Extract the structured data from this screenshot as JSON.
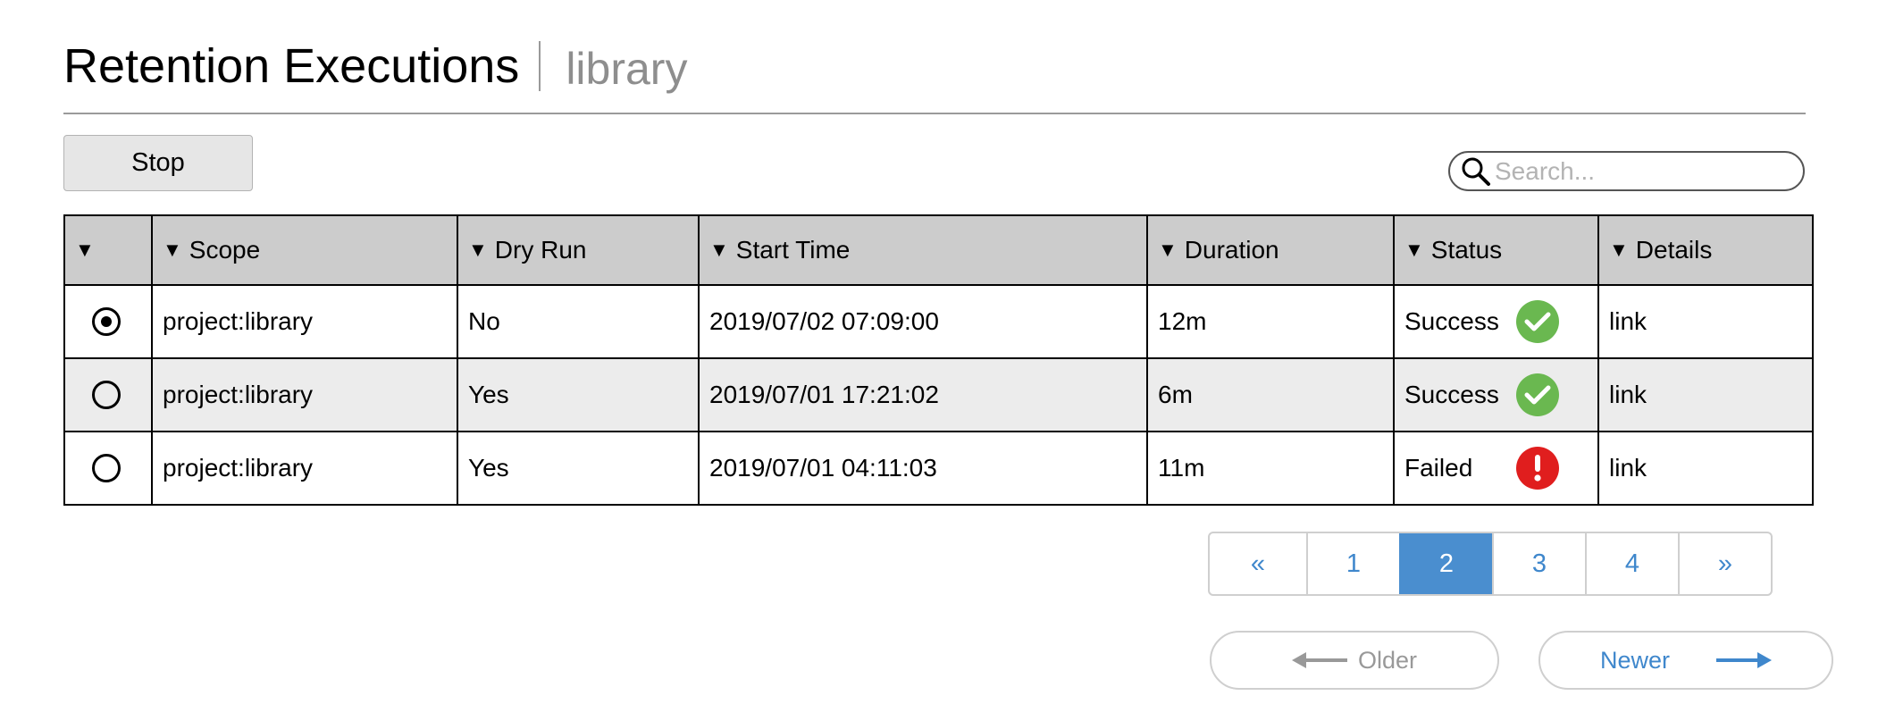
{
  "header": {
    "title": "Retention Executions",
    "subtitle": "library"
  },
  "toolbar": {
    "stop_label": "Stop"
  },
  "search": {
    "placeholder": "Search..."
  },
  "table": {
    "columns": [
      "",
      "Scope",
      "Dry Run",
      "Start Time",
      "Duration",
      "Status",
      "Details"
    ],
    "rows": [
      {
        "selected": true,
        "scope": "project:library",
        "dry_run": "No",
        "start_time": "2019/07/02 07:09:00",
        "duration": "12m",
        "status": "Success",
        "status_icon": "check-icon",
        "details": "link"
      },
      {
        "selected": false,
        "scope": "project:library",
        "dry_run": "Yes",
        "start_time": "2019/07/01 17:21:02",
        "duration": "6m",
        "status": "Success",
        "status_icon": "check-icon",
        "details": "link"
      },
      {
        "selected": false,
        "scope": "project:library",
        "dry_run": "Yes",
        "start_time": "2019/07/01 04:11:03",
        "duration": "11m",
        "status": "Failed",
        "status_icon": "exclamation-icon",
        "details": "link"
      }
    ]
  },
  "pagination": {
    "prev": "«",
    "pages": [
      "1",
      "2",
      "3",
      "4"
    ],
    "current": "2",
    "next": "»"
  },
  "nav": {
    "older": "Older",
    "newer": "Newer"
  },
  "colors": {
    "accent": "#4a8ecf",
    "success": "#6ab850",
    "failure": "#e01e1e",
    "header_bg": "#cccccc",
    "alt_row_bg": "#ececec"
  }
}
